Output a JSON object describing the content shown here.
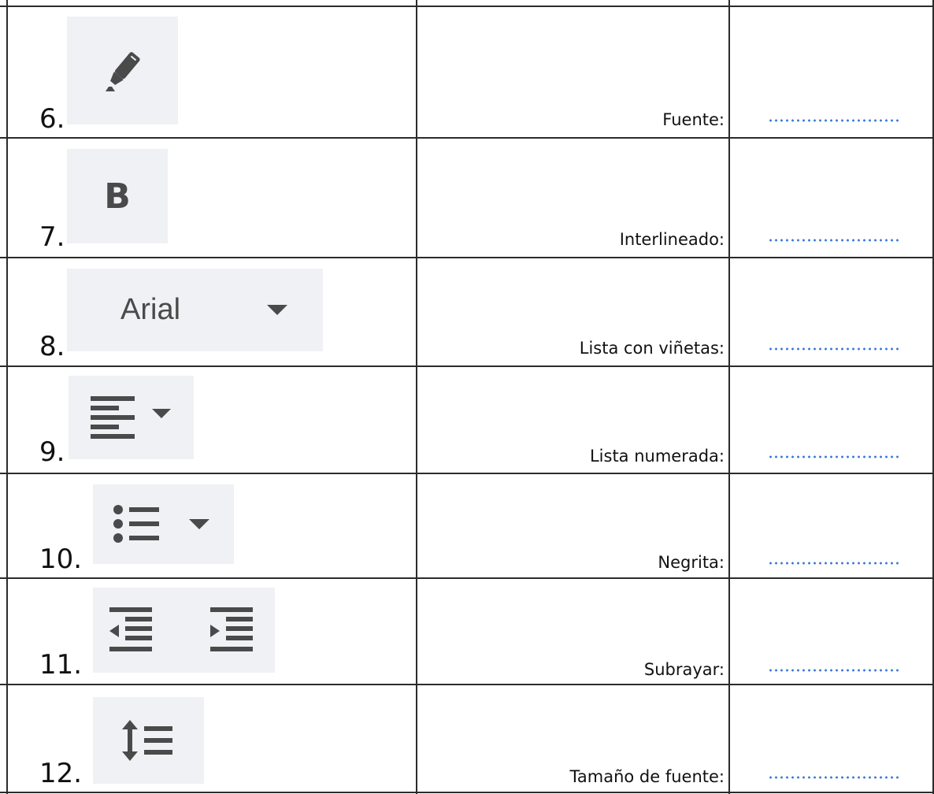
{
  "rows": [
    {
      "number": "6.",
      "icon": "highlighter-pen-icon",
      "label": "Fuente:"
    },
    {
      "number": "7.",
      "icon": "bold-icon",
      "icon_text": "B",
      "label": "Interlineado:"
    },
    {
      "number": "8.",
      "icon": "font-family-dropdown",
      "icon_text": "Arial",
      "label": "Lista con viñetas:"
    },
    {
      "number": "9.",
      "icon": "align-left-dropdown-icon",
      "label": "Lista numerada:"
    },
    {
      "number": "10.",
      "icon": "bulleted-list-dropdown-icon",
      "label": "Negrita:"
    },
    {
      "number": "11.",
      "icon": "indent-decrease-increase-icons",
      "label": "Subrayar:"
    },
    {
      "number": "12.",
      "icon": "line-spacing-icon",
      "label": "Tamaño de fuente:"
    }
  ],
  "colors": {
    "dots": "#3a78d6",
    "icon_bg": "#eff1f4",
    "icon_fg": "#4a4a4a",
    "lines": "#2b2b2b"
  }
}
